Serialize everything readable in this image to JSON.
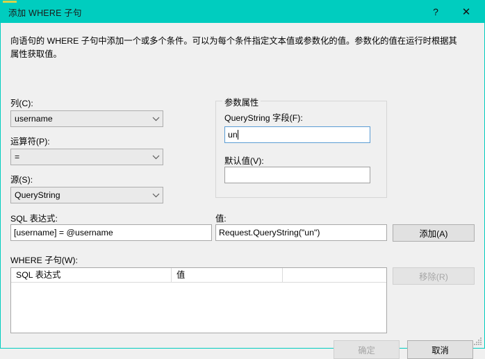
{
  "window": {
    "title": "添加 WHERE 子句",
    "help_icon": "question-mark-icon",
    "close_icon": "close-icon"
  },
  "description": "向语句的 WHERE 子句中添加一个或多个条件。可以为每个条件指定文本值或参数化的值。参数化的值在运行时根据其属性获取值。",
  "left_panel": {
    "column_label": "列(C):",
    "column_value": "username",
    "operator_label": "运算符(P):",
    "operator_value": "=",
    "source_label": "源(S):",
    "source_value": "QueryString"
  },
  "parameter_properties": {
    "group_title": "参数属性",
    "field_label": "QueryString 字段(F):",
    "field_value": "un",
    "default_label": "默认值(V):",
    "default_value": ""
  },
  "expression_row": {
    "sql_label": "SQL 表达式:",
    "sql_value": "[username] = @username",
    "value_label": "值:",
    "value_value": "Request.QueryString(\"un\")",
    "add_button": "添加(A)"
  },
  "where_clause": {
    "label": "WHERE 子句(W):",
    "columns": [
      "SQL 表达式",
      "值",
      ""
    ],
    "rows": [],
    "remove_button": "移除(R)"
  },
  "footer": {
    "ok_button": "确定",
    "cancel_button": "取消"
  },
  "colors": {
    "titlebar": "#00cdbf",
    "dialog_bg": "#f0f0f0",
    "focus_border": "#5a9cd4",
    "button_bg": "#e1e1e1",
    "disabled_text": "#a6a6a6"
  }
}
